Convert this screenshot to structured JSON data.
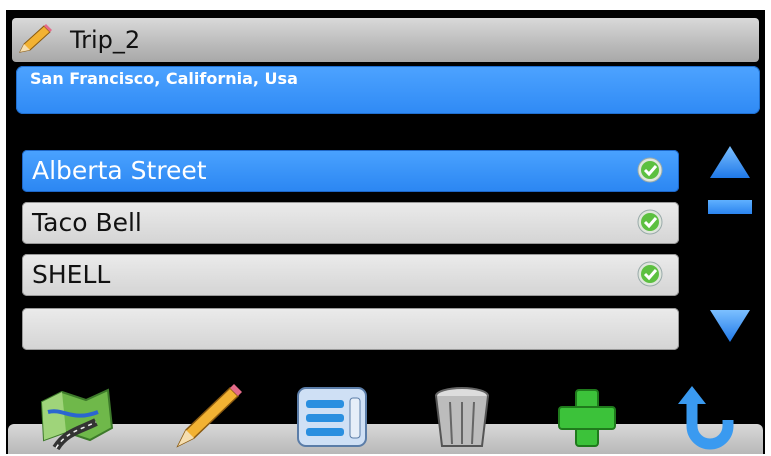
{
  "window": {
    "title": "Trip_2"
  },
  "location": {
    "text": "San Francisco, California, Usa"
  },
  "trip_stops": [
    {
      "label": "Alberta Street",
      "checked": true,
      "selected": true
    },
    {
      "label": "Taco Bell",
      "checked": true,
      "selected": false
    },
    {
      "label": "SHELL",
      "checked": true,
      "selected": false
    },
    {
      "label": "",
      "checked": false,
      "selected": false
    }
  ],
  "icons": {
    "title": "pencil-icon",
    "check": "checkmark-icon",
    "scroll_up": "arrow-up-icon",
    "scroll_down": "arrow-down-icon",
    "toolbar": [
      "map-icon",
      "pencil-icon",
      "list-icon",
      "trash-icon",
      "plus-icon",
      "back-icon"
    ]
  },
  "colors": {
    "accent": "#2f8af5",
    "background": "#000000",
    "check": "#5cc040"
  }
}
